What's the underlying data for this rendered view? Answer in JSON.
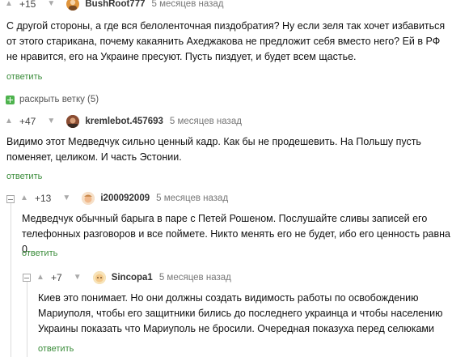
{
  "comments": [
    {
      "score": "+15",
      "nick": "BushRoot777",
      "time": "5 месяцев назад",
      "text": "С другой стороны, а где вся белоленточная пиздобратия? Ну если зеля так хочет избавиться от этого старикана, почему какаянить Ахеджакова не предложит себя вместо него? Ей в РФ не нравится, его на Украине пресуют. Пусть пиздует, и будет всем щастье.",
      "reply": "ответить",
      "avatar_color": "#e0953c"
    },
    {
      "score": "+47",
      "nick": "kremlebot.457693",
      "time": "5 месяцев назад",
      "text": "Видимо этот Медведчук сильно ценный кадр. Как бы не продешевить. На Польшу пусть поменяет, целиком.  И часть Эстонии.",
      "reply": "ответить",
      "avatar_color": "#9b5a3c"
    },
    {
      "score": "+13",
      "nick": "i200092009",
      "time": "5 месяцев назад",
      "text": "Медведчук обычный барыга в паре с Петей Рошеном. Послушайте сливы записей его телефонных разговоров и все поймете. Никто менять его не будет, ибо его ценность равна 0.",
      "reply": "ответить",
      "avatar_color": "#f0c9a8"
    },
    {
      "score": "+7",
      "nick": "Sincopa1",
      "time": "5 месяцев назад",
      "text": "Киев это понимает. Но они должны создать видимость работы по освобождению Мариуполя, чтобы его защитники бились до последнего украинца и чтобы населению Украины показать что Мариуполь не бросили. Очередная показуха перед селюками",
      "reply": "ответить",
      "avatar_color": "#f3d6a4"
    }
  ],
  "expand_branch": "раскрыть ветку (5)",
  "icons": {
    "up": "arrow-up-icon",
    "down": "arrow-down-icon",
    "collapse": "collapse-thread-icon",
    "expand": "expand-thread-icon"
  }
}
